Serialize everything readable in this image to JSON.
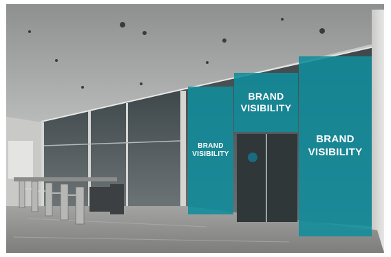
{
  "scene": {
    "description_colors": {
      "banner": "#108c9b",
      "ceiling": "#9b9d9d",
      "floor": "#8d8e8c",
      "wall": "#d6d6d4",
      "glass": "#4c5558"
    }
  },
  "banners": {
    "left": {
      "line1": "BRAND",
      "line2": "VISIBILITY"
    },
    "center": {
      "line1": "BRAND",
      "line2": "VISIBILITY"
    },
    "right": {
      "line1": "BRAND",
      "line2": "VISIBILITY"
    }
  }
}
